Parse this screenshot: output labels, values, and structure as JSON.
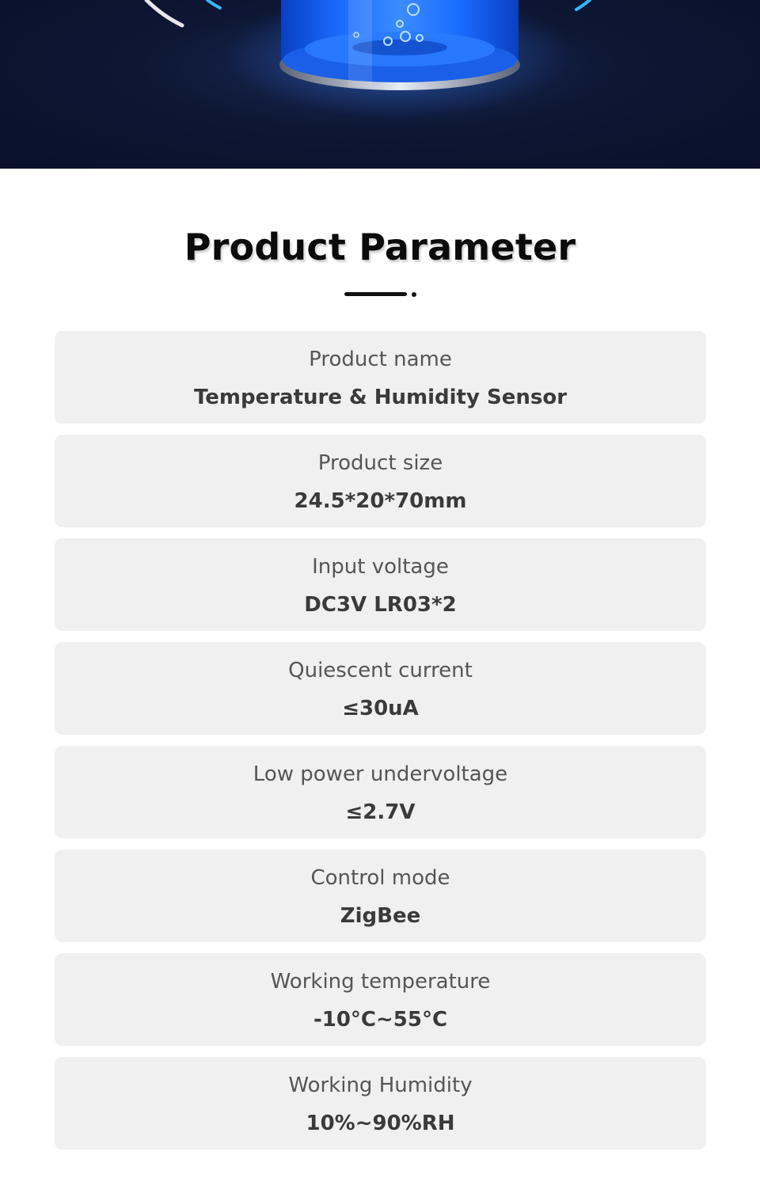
{
  "section_title": "Product Parameter",
  "colors": {
    "hero_background": "#0d1634",
    "card_background": "#f0f0f0",
    "label_text": "#555555",
    "value_text": "#3a3a3a",
    "accent_blue": "#1e6bff"
  },
  "params": [
    {
      "label": "Product name",
      "value": "Temperature & Humidity Sensor"
    },
    {
      "label": "Product size",
      "value": "24.5*20*70mm"
    },
    {
      "label": "Input voltage",
      "value": "DC3V LR03*2"
    },
    {
      "label": "Quiescent current",
      "value": "≤30uA"
    },
    {
      "label": "Low power undervoltage",
      "value": "≤2.7V"
    },
    {
      "label": "Control mode",
      "value": "ZigBee"
    },
    {
      "label": "Working temperature",
      "value": "-10°C~55°C"
    },
    {
      "label": "Working Humidity",
      "value": "10%~90%RH"
    }
  ]
}
